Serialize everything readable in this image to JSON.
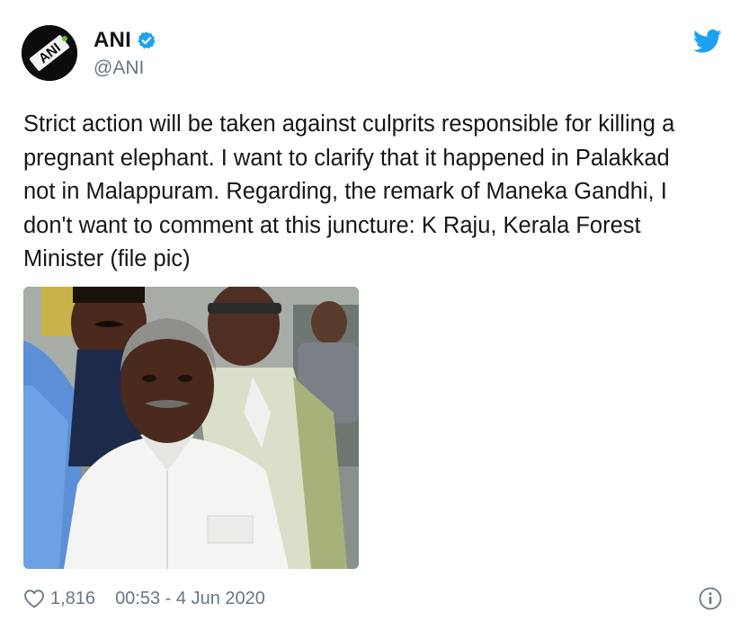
{
  "author": {
    "display_name": "ANI",
    "handle": "@ANI",
    "verified": true,
    "avatar_text": "ANI"
  },
  "tweet": {
    "text": "Strict action will be taken against culprits responsible for killing a\npregnant elephant. I want to clarify that it happened in Palakkad\nnot in Malappuram. Regarding, the remark of Maneka Gandhi, I\ndon't want to comment at this juncture: K Raju, Kerala Forest\nMinister (file pic)"
  },
  "footer": {
    "likes": "1,816",
    "timestamp": "00:53 - 4 Jun 2020"
  },
  "icons": {
    "verified": "verified-badge-icon",
    "twitter": "twitter-bird-icon",
    "like": "heart-icon",
    "info": "info-icon"
  },
  "colors": {
    "twitter_blue": "#1da1f2",
    "text": "#14171a",
    "secondary_text": "#657786"
  }
}
